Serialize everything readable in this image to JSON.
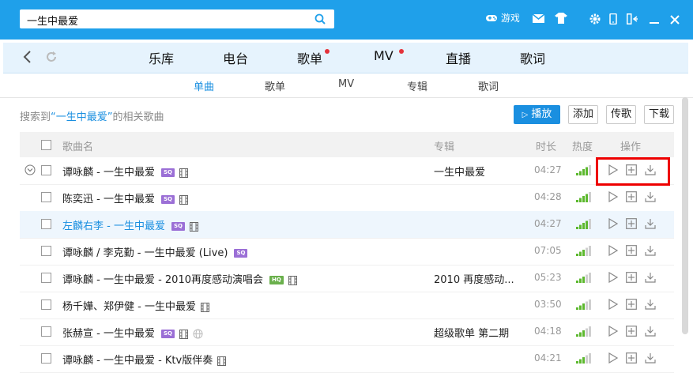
{
  "search": {
    "value": "一生中最爱"
  },
  "top_bar": {
    "game_label": "游戏"
  },
  "nav": {
    "items": [
      {
        "label": "乐库",
        "dot": false
      },
      {
        "label": "电台",
        "dot": false
      },
      {
        "label": "歌单",
        "dot": true
      },
      {
        "label": "MV",
        "dot": true
      },
      {
        "label": "直播",
        "dot": false
      },
      {
        "label": "歌词",
        "dot": false
      }
    ]
  },
  "subtabs": [
    "单曲",
    "歌单",
    "MV",
    "专辑",
    "歌词"
  ],
  "result": {
    "prefix": "搜索到",
    "query": "“一生中最爱”",
    "suffix": "的相关歌曲"
  },
  "actions": {
    "play": "播放",
    "add": "添加",
    "share": "传歌",
    "download": "下载"
  },
  "table": {
    "headers": {
      "name": "歌曲名",
      "album": "专辑",
      "duration": "时长",
      "heat": "热度",
      "ops": "操作"
    },
    "rows": [
      {
        "name": "谭咏麟 - 一生中最爱",
        "badge": "SQ",
        "mv": true,
        "globe": false,
        "album": "一生中最爱",
        "duration": "04:27",
        "heat": 4,
        "highlight": false,
        "blue": false,
        "expand": true
      },
      {
        "name": "陈奕迅 - 一生中最爱",
        "badge": "SQ",
        "mv": true,
        "globe": false,
        "album": "",
        "duration": "04:28",
        "heat": 4,
        "highlight": false,
        "blue": false,
        "expand": false
      },
      {
        "name": "左麟右李 - 一生中最爱",
        "badge": "SQ",
        "mv": true,
        "globe": false,
        "album": "",
        "duration": "04:27",
        "heat": 4,
        "highlight": true,
        "blue": true,
        "expand": false
      },
      {
        "name": "谭咏麟 / 李克勤 - 一生中最爱 (Live)",
        "badge": "SQ",
        "mv": false,
        "globe": false,
        "album": "",
        "duration": "07:05",
        "heat": 3,
        "highlight": false,
        "blue": false,
        "expand": false
      },
      {
        "name": "谭咏麟 - 一生中最爱 - 2010再度感动演唱会",
        "badge": "HQ",
        "mv": true,
        "globe": false,
        "album": "2010 再度感动...",
        "duration": "05:23",
        "heat": 3,
        "highlight": false,
        "blue": false,
        "expand": false
      },
      {
        "name": "杨千嬅、郑伊健 - 一生中最爱",
        "badge": "",
        "mv": true,
        "globe": false,
        "album": "",
        "duration": "03:50",
        "heat": 3,
        "highlight": false,
        "blue": false,
        "expand": false
      },
      {
        "name": "张赫宣 - 一生中最爱",
        "badge": "SQ",
        "mv": true,
        "globe": true,
        "album": "超级歌单 第二期",
        "duration": "04:18",
        "heat": 3,
        "highlight": false,
        "blue": false,
        "expand": false
      },
      {
        "name": "谭咏麟 - 一生中最爱 - Ktv版伴奏",
        "badge": "",
        "mv": true,
        "globe": false,
        "album": "",
        "duration": "04:21",
        "heat": 3,
        "highlight": false,
        "blue": false,
        "expand": false
      }
    ]
  },
  "colors": {
    "accent": "#1fa0ea",
    "link": "#1a8fe0",
    "heat": "#5cb82e",
    "highlight_box": "#e00000"
  }
}
